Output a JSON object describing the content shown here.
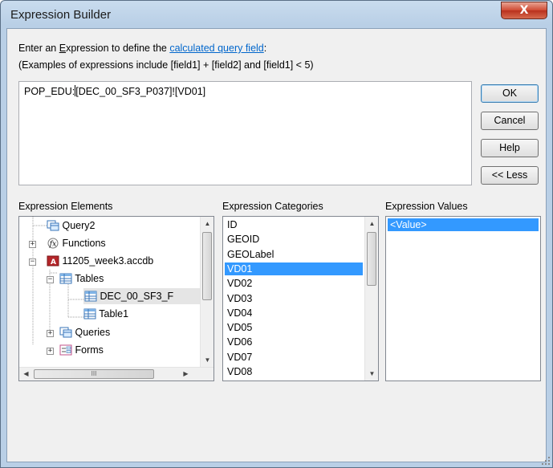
{
  "window": {
    "title": "Expression Builder",
    "close_glyph": "X"
  },
  "prompt": {
    "line1_before": "Enter an ",
    "line1_ex_first": "E",
    "line1_ex_rest": "xpression to define the ",
    "line1_link": "calculated query field",
    "line1_after": ":",
    "line2": "(Examples of expressions include [field1] + [field2] and [field1] < 5)"
  },
  "expression": {
    "before_caret": "POP_EDU:",
    "after_caret": "[DEC_00_SF3_P037]![VD01]"
  },
  "buttons": {
    "ok": "OK",
    "cancel": "Cancel",
    "help": "Help",
    "less": "<< Less"
  },
  "elements": {
    "label": "Expression Elements",
    "items": {
      "query2": "Query2",
      "functions": "Functions",
      "db": "11205_week3.accdb",
      "tables": "Tables",
      "dec": "DEC_00_SF3_F",
      "table1": "Table1",
      "queries": "Queries",
      "forms": "Forms"
    },
    "hscroll_thumb": "III"
  },
  "categories": {
    "label": "Expression Categories",
    "items": [
      "ID",
      "GEOID",
      "GEOLabel",
      "VD01",
      "VD02",
      "VD03",
      "VD04",
      "VD05",
      "VD06",
      "VD07",
      "VD08"
    ],
    "selected": "VD01"
  },
  "values": {
    "label": "Expression Values",
    "items": [
      "<Value>"
    ]
  },
  "icons": [
    "close-icon",
    "query-icon",
    "function-icon",
    "database-icon",
    "table-icon",
    "forms-icon",
    "scroll-up-arrow-icon",
    "scroll-down-arrow-icon",
    "scroll-left-arrow-icon",
    "scroll-right-arrow-icon",
    "resize-grip-icon"
  ],
  "colors": {
    "selection": "#3399ff",
    "link": "#0066cc",
    "title_gradient": "#c9dcee",
    "close_button": "#cf4a32"
  }
}
